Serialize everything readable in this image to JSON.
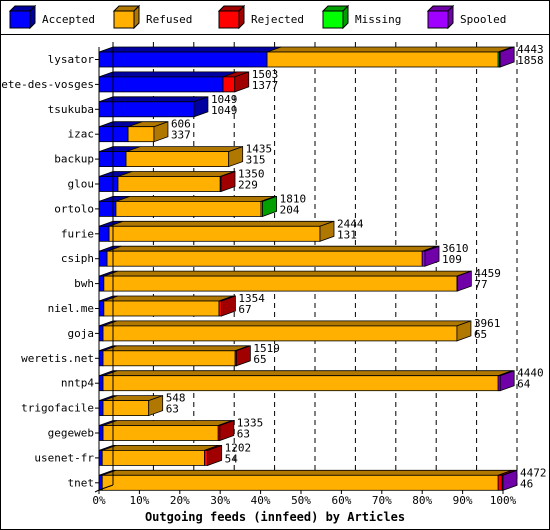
{
  "chart_data": {
    "type": "bar",
    "orientation": "horizontal",
    "stacked": true,
    "style": "3d",
    "title": "",
    "xlabel": "Outgoing feeds (innfeed) by Articles",
    "ylabel": "",
    "xlim": [
      0,
      100
    ],
    "x_unit": "%",
    "x_ticks": [
      "0%",
      "10%",
      "20%",
      "30%",
      "40%",
      "50%",
      "60%",
      "70%",
      "80%",
      "90%",
      "100%"
    ],
    "grid": true,
    "legend_position": "top",
    "legend": [
      {
        "name": "Accepted",
        "color": "#0000ff",
        "side": "#0000a0"
      },
      {
        "name": "Refused",
        "color": "#ffb000",
        "side": "#b07800"
      },
      {
        "name": "Rejected",
        "color": "#ff0000",
        "side": "#a00000"
      },
      {
        "name": "Missing",
        "color": "#00ff00",
        "side": "#00a000"
      },
      {
        "name": "Spooled",
        "color": "#a000ff",
        "side": "#7000a8"
      }
    ],
    "categories": [
      "lysator",
      "bete-des-vosges",
      "tsukuba",
      "izac",
      "backup",
      "glou",
      "ortolo",
      "furie",
      "csiph",
      "bwh",
      "niel.me",
      "goja",
      "weretis.net",
      "nntp4",
      "trigofacile",
      "gegeweb",
      "usenet-fr",
      "tnet"
    ],
    "totals": [
      4443,
      1503,
      1049,
      606,
      1435,
      1350,
      1810,
      2444,
      3610,
      4459,
      1354,
      3961,
      1519,
      4440,
      548,
      1335,
      1202,
      4472
    ],
    "accepted_counts": [
      1858,
      1377,
      1049,
      337,
      315,
      229,
      204,
      131,
      109,
      77,
      67,
      65,
      65,
      64,
      63,
      63,
      54,
      46
    ],
    "series": [
      {
        "name": "Accepted",
        "values": [
          41.6,
          30.7,
          23.5,
          7.2,
          6.7,
          4.7,
          4.2,
          2.5,
          2.0,
          1.2,
          1.2,
          1.0,
          1.0,
          1.0,
          1.0,
          1.0,
          0.8,
          0.8
        ]
      },
      {
        "name": "Refused",
        "values": [
          57.2,
          0,
          0,
          6.4,
          25.4,
          25.3,
          35.9,
          52.2,
          78.0,
          87.4,
          28.5,
          87.6,
          32.7,
          97.8,
          11.3,
          28.5,
          25.3,
          98.0
        ]
      },
      {
        "name": "Rejected",
        "values": [
          0,
          2.9,
          0,
          0,
          0,
          0.2,
          0,
          0,
          0,
          0,
          0.6,
          0,
          0.3,
          0,
          0,
          0.4,
          0.8,
          1.0
        ]
      },
      {
        "name": "Missing",
        "values": [
          0.3,
          0,
          0,
          0,
          0,
          0,
          0.4,
          0,
          0,
          0,
          0,
          0,
          0,
          0,
          0,
          0,
          0,
          0
        ]
      },
      {
        "name": "Spooled",
        "values": [
          0.2,
          0,
          0,
          0,
          0,
          0,
          0,
          0,
          0.7,
          0.1,
          0,
          0,
          0,
          0.5,
          0,
          0,
          0,
          0.2
        ]
      }
    ]
  }
}
